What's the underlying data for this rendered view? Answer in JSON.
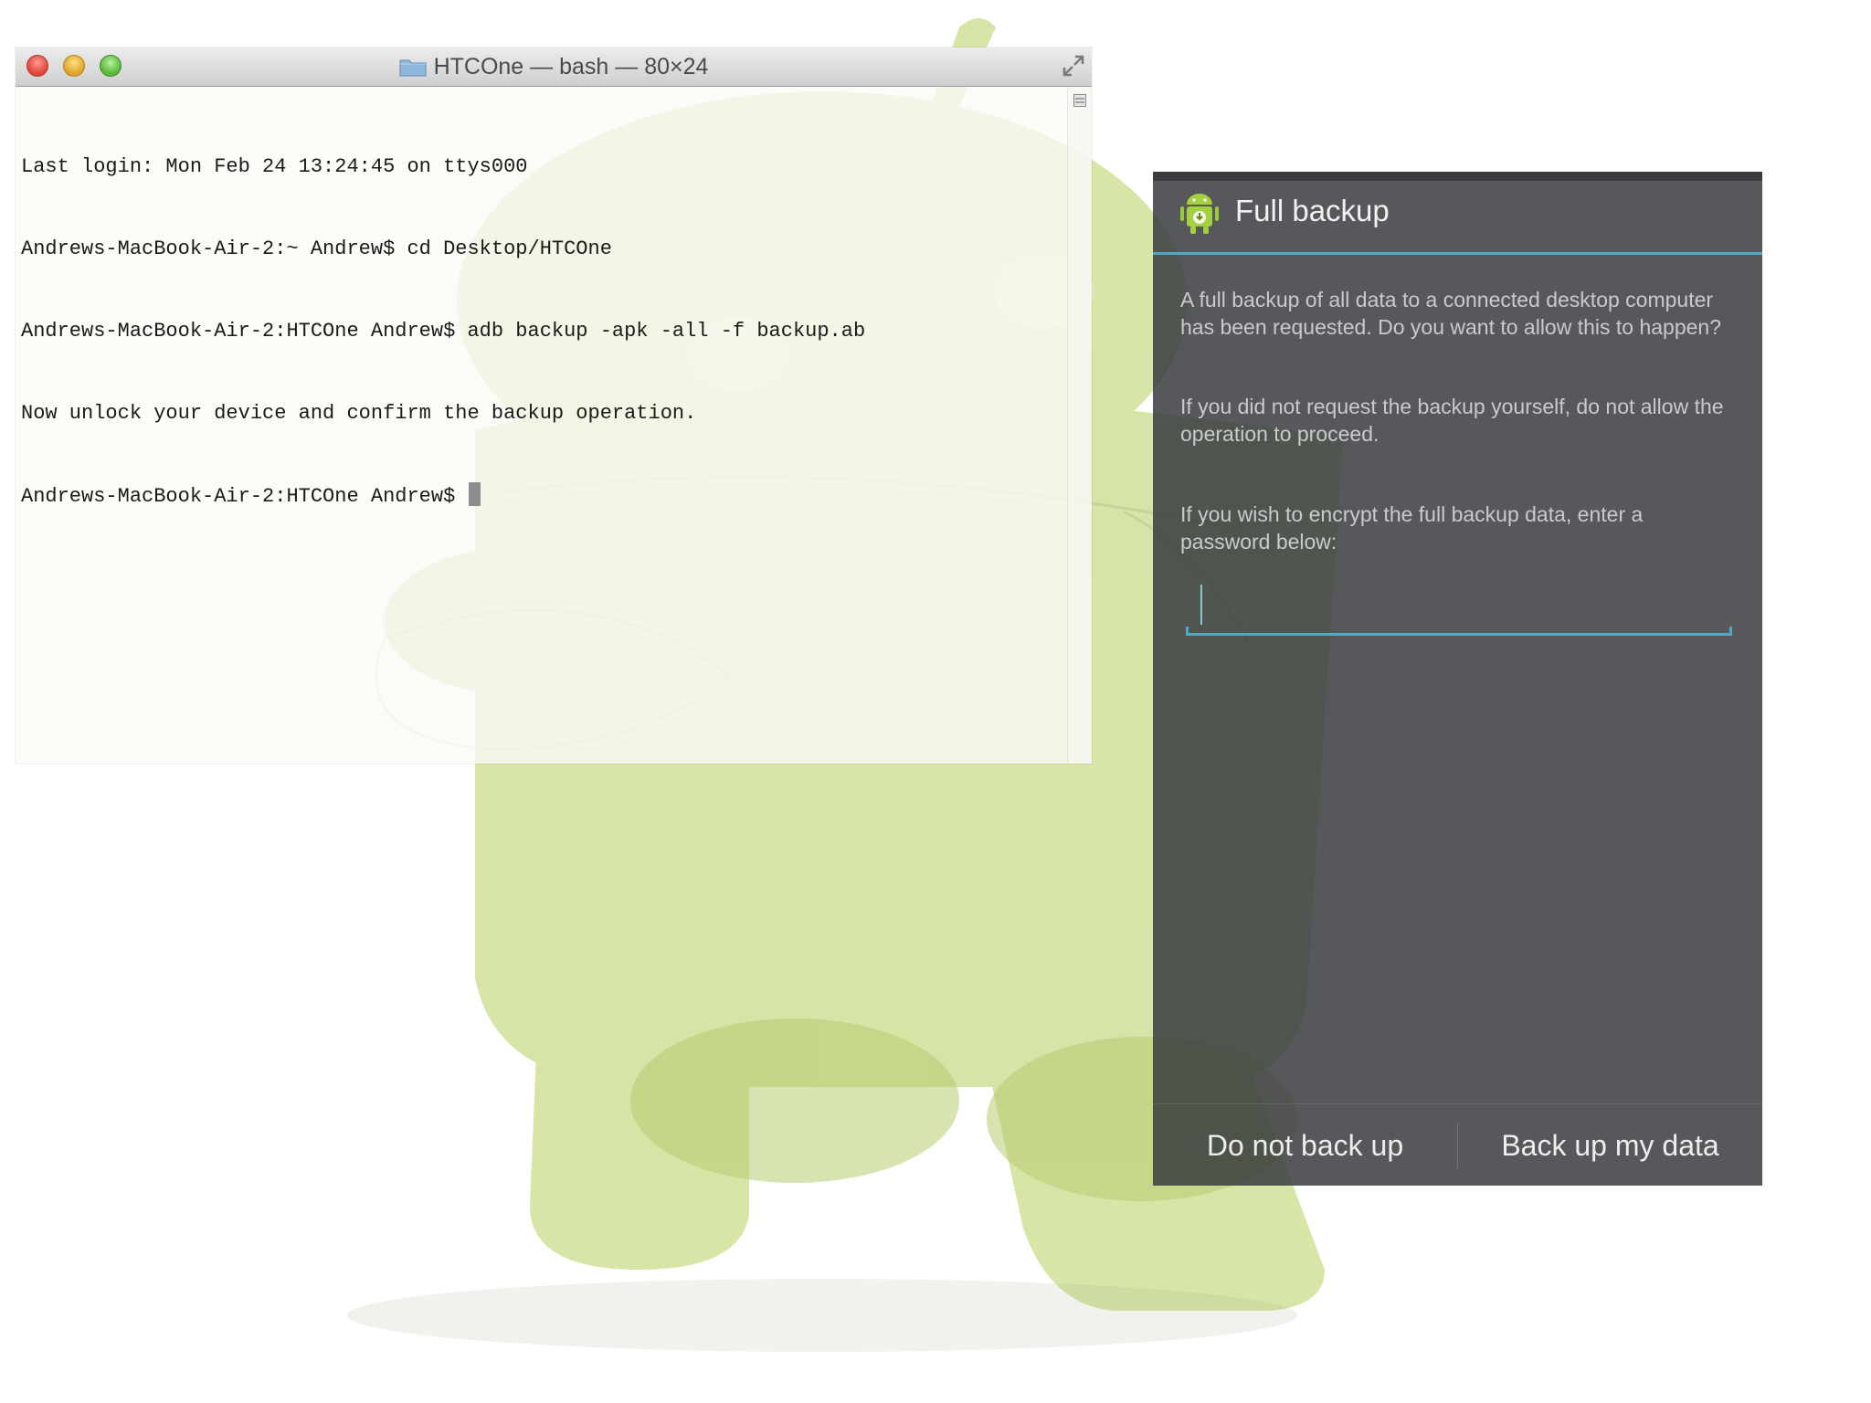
{
  "terminal": {
    "title": "HTCOne — bash — 80×24",
    "lines": [
      "Last login: Mon Feb 24 13:24:45 on ttys000",
      "Andrews-MacBook-Air-2:~ Andrew$ cd Desktop/HTCOne",
      "Andrews-MacBook-Air-2:HTCOne Andrew$ adb backup -apk -all -f backup.ab",
      "Now unlock your device and confirm the backup operation.",
      "Andrews-MacBook-Air-2:HTCOne Andrew$ "
    ],
    "icons": {
      "close": "close-button",
      "minimize": "minimize-button",
      "zoom": "zoom-button",
      "folder": "folder-icon",
      "resize": "fullscreen-icon"
    }
  },
  "dialog": {
    "title": "Full backup",
    "paragraph_1": "A full backup of all data to a connected desktop computer has been requested. Do you want to allow this to happen?",
    "paragraph_2": "If you did not request the backup yourself, do not allow the operation to proceed.",
    "paragraph_3": "If you wish to encrypt the full backup data, enter a password below:",
    "password_value": "",
    "buttons": {
      "negative": "Do not back up",
      "positive": "Back up my data"
    },
    "accent_color": "#4fa9c6",
    "icon": "android-backup-icon"
  },
  "colors": {
    "android_green": "#a4c639",
    "dialog_bg": "#3a3c40"
  }
}
